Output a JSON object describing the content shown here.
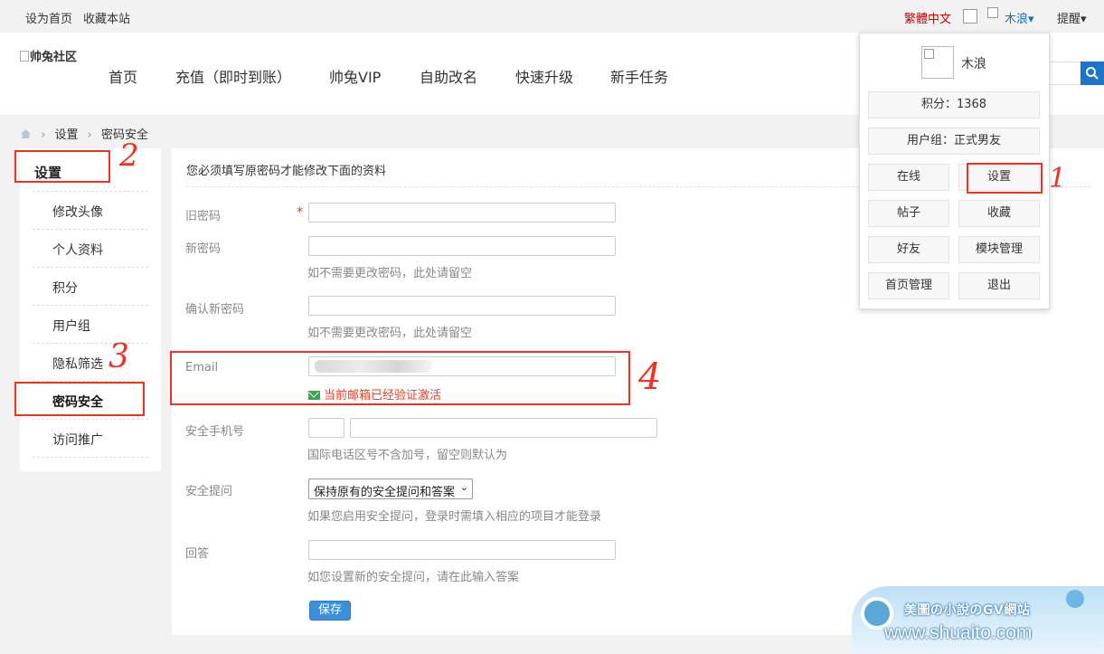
{
  "topbar": {
    "set_home": "设为首页",
    "bookmark": "收藏本站",
    "lang": "繁體中文",
    "username": "木浪▾",
    "remind": "提醒▾"
  },
  "header": {
    "logo_alt": "帅兔社区",
    "nav": [
      "首页",
      "充值（即时到账）",
      "帅兔VIP",
      "自助改名",
      "快速升级",
      "新手任务"
    ]
  },
  "breadcrumb": {
    "settings": "设置",
    "current": "密码安全"
  },
  "sidebar": {
    "title": "设置",
    "items": [
      {
        "label": "修改头像"
      },
      {
        "label": "个人资料"
      },
      {
        "label": "积分"
      },
      {
        "label": "用户组"
      },
      {
        "label": "隐私筛选"
      },
      {
        "label": "密码安全"
      },
      {
        "label": "访问推广"
      }
    ]
  },
  "form": {
    "note": "您必须填写原密码才能修改下面的资料",
    "old_password": "旧密码",
    "required_mark": "*",
    "new_password": "新密码",
    "new_password_hint": "如不需要更改密码，此处请留空",
    "confirm_password": "确认新密码",
    "confirm_password_hint": "如不需要更改密码，此处请留空",
    "email": "Email",
    "email_verified": "当前邮箱已经验证激活",
    "phone": "安全手机号",
    "phone_hint": "国际电话区号不含加号，留空则默认为",
    "question": "安全提问",
    "question_selected": "保持原有的安全提问和答案",
    "question_hint": "如果您启用安全提问，登录时需填入相应的项目才能登录",
    "answer": "回答",
    "answer_hint": "如您设置新的安全提问，请在此输入答案",
    "save": "保存"
  },
  "dropdown": {
    "name": "木浪",
    "points": "积分：1368",
    "group": "用户组：正式男友",
    "buttons": [
      "在线",
      "设置",
      "帖子",
      "收藏",
      "好友",
      "模块管理",
      "首页管理",
      "退出"
    ]
  },
  "annotations": [
    "1",
    "2",
    "3",
    "4"
  ],
  "watermark": {
    "line1": "美圖の小說のGV網站",
    "line2": "www.shuaito.com"
  },
  "colors": {
    "accent": "#1a74c7",
    "annotation": "#e32222",
    "verified": "#e8402b"
  }
}
